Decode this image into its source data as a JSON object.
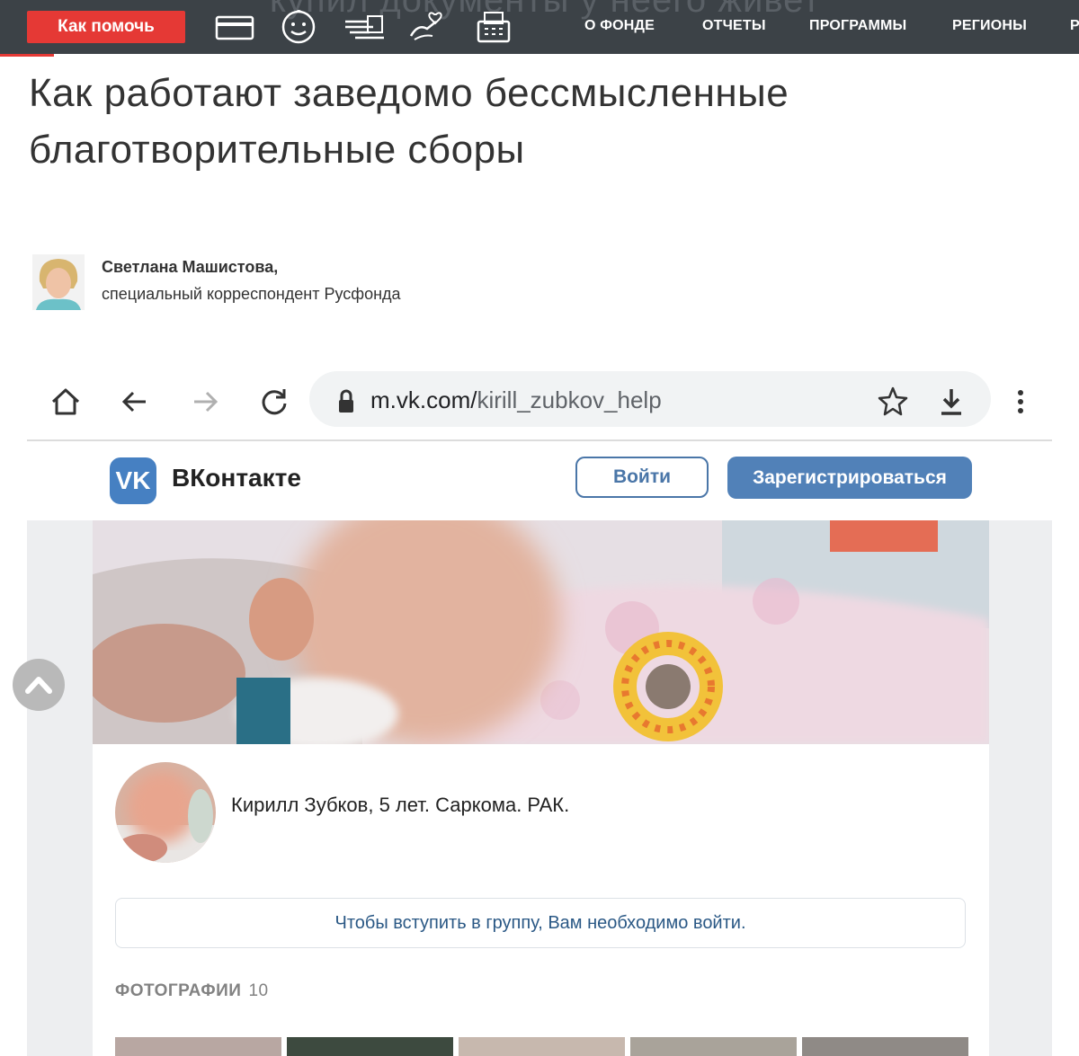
{
  "topnav": {
    "ghost_text": "купил документы у неего живет",
    "help_button": "Как помочь",
    "links": [
      "О ФОНДЕ",
      "ОТЧЕТЫ",
      "ПРОГРАММЫ",
      "РЕГИОНЫ",
      "Р"
    ],
    "icons": [
      "card-icon",
      "smiley-icon",
      "hand-money-icon",
      "heart-hand-icon",
      "fax-icon"
    ]
  },
  "article": {
    "title": "Как работают заведомо бессмысленные благотворительные сборы",
    "author_name": "Светлана Машистова,",
    "author_role": "специальный корреспондент Русфонда"
  },
  "browser": {
    "url_host": "m.vk.com/",
    "url_path": "kirill_zubkov_help"
  },
  "vk": {
    "logo_text": "VK",
    "site_name": "ВКонтакте",
    "login_label": "Войти",
    "register_label": "Зарегистрироваться",
    "group_title": "Кирилл Зубков, 5 лет. Саркома. РАК.",
    "join_notice": "Чтобы вступить в группу, Вам необходимо войти.",
    "photos_label": "ФОТОГРАФИИ",
    "photos_count": "10"
  },
  "colors": {
    "nav_bg": "#3c4247",
    "accent_red": "#e53935",
    "vk_blue": "#5181b8",
    "vk_link": "#2a5885"
  }
}
